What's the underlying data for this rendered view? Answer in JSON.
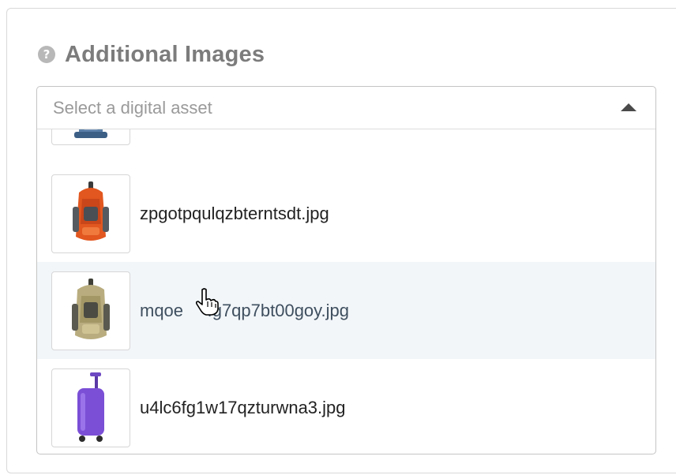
{
  "section": {
    "title": "Additional Images",
    "help_icon": "question-mark-icon"
  },
  "select": {
    "placeholder": "Select a digital asset",
    "caret_icon": "caret-up-icon",
    "options": [
      {
        "filename": "",
        "thumbnail": "blue-backpack-image",
        "partial": true
      },
      {
        "filename": "zpgotpqulqzbterntsdt.jpg",
        "thumbnail": "orange-backpack-image"
      },
      {
        "filename": "mqoe     fg7qp7bt00goy.jpg",
        "thumbnail": "tan-backpack-image",
        "highlighted": true
      },
      {
        "filename": "u4lc6fg1w17qzturwna3.jpg",
        "thumbnail": "purple-suitcase-image"
      }
    ]
  },
  "cursor": "hand-pointer-icon",
  "colors": {
    "title": "#7c7c7c",
    "placeholder": "#9a9a9a",
    "highlight_row": "#f2f6f9",
    "border": "#c4c4c4"
  }
}
